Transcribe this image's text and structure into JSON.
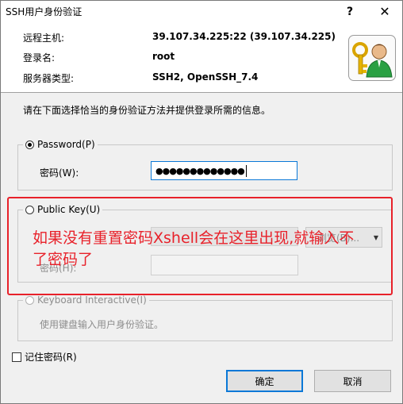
{
  "window": {
    "title": "SSH用户身份验证",
    "help_label": "?",
    "close_label": "✕"
  },
  "info": {
    "remote_host_label": "远程主机:",
    "remote_host_value": "39.107.34.225:22 (39.107.34.225)",
    "login_name_label": "登录名:",
    "login_name_value": "root",
    "server_type_label": "服务器类型:",
    "server_type_value": "SSH2, OpenSSH_7.4"
  },
  "instructions": "请在下面选择恰当的身份验证方法并提供登录所需的信息。",
  "password_section": {
    "radio_label": "Password(P)",
    "field_label": "密码(W):",
    "masked_value": "●●●●●●●●●●●●●"
  },
  "public_key_section": {
    "radio_label": "Public Key(U)",
    "key_label": "用户密钥(K):",
    "passphrase_label": "密码(H):",
    "browse_label": "浏览(B)...",
    "browse_dropdown": "▼"
  },
  "keyboard_section": {
    "radio_label": "Keyboard Interactive(I)",
    "description": "使用键盘输入用户身份验证。"
  },
  "annotation": {
    "text": "如果没有重置密码Xshell会在这里出现,就输入不了密码了",
    "color": "#e8212a"
  },
  "remember_password_label": "记住密码(R)",
  "buttons": {
    "ok_label": "确定",
    "cancel_label": "取消"
  },
  "colors": {
    "accent": "#0a78d7",
    "annotation_red": "#e8212a"
  }
}
